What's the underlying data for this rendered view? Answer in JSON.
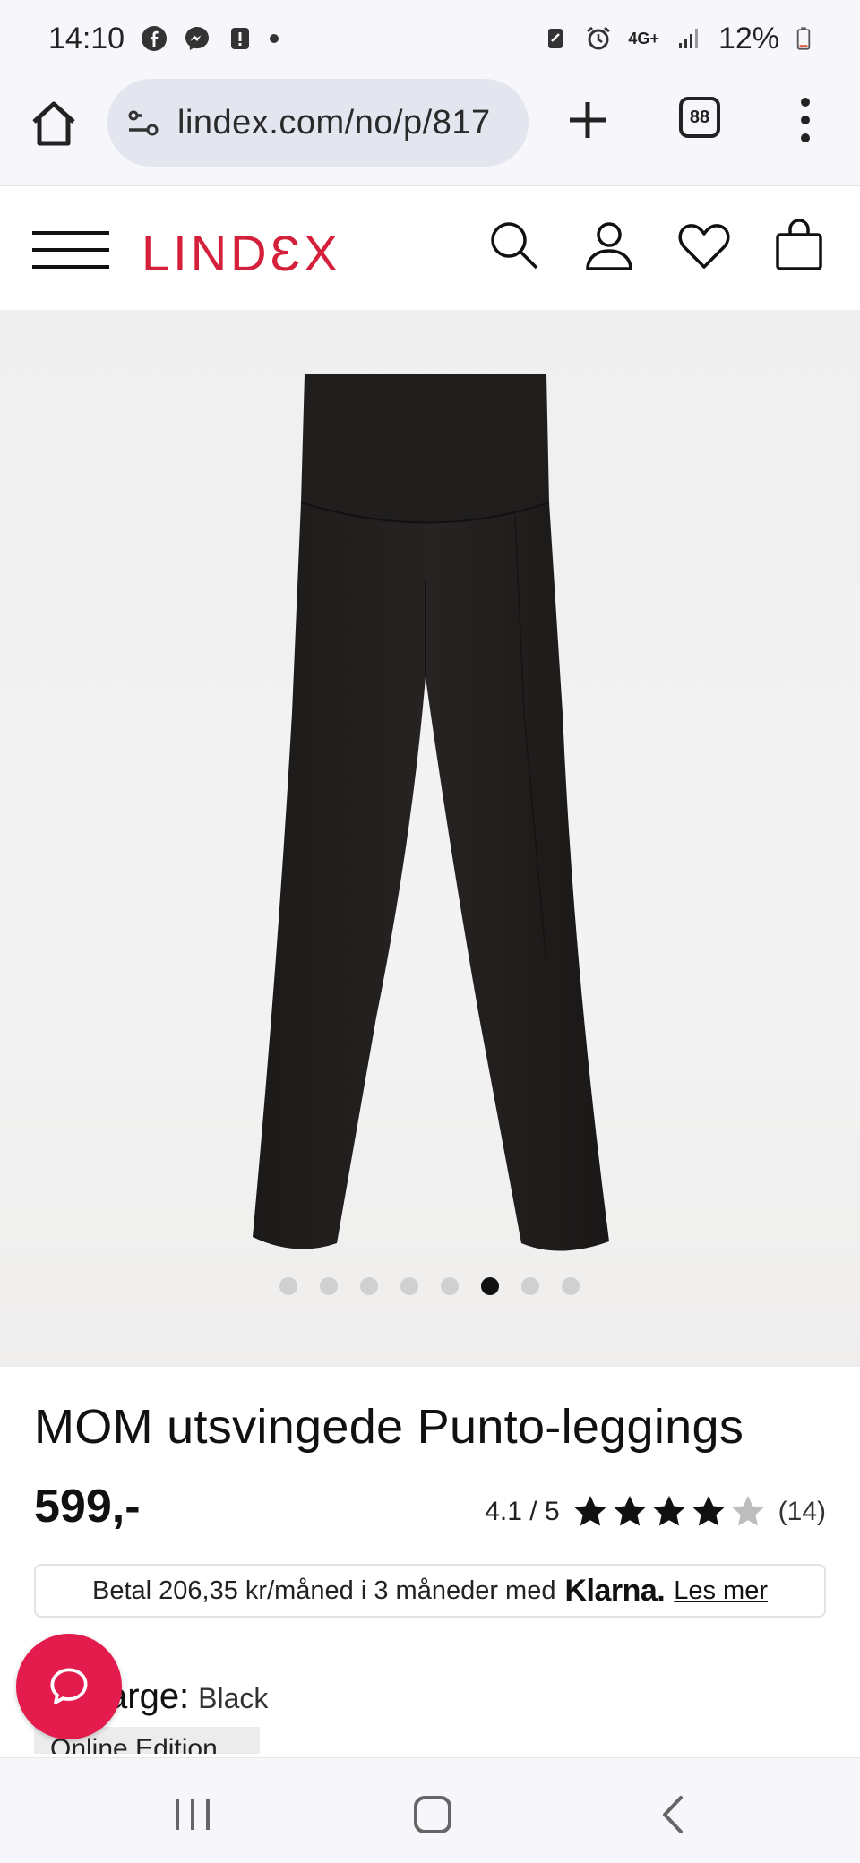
{
  "status_bar": {
    "time": "14:10",
    "battery": "12%",
    "network": "4G+",
    "icons": [
      "facebook-icon",
      "messenger-icon",
      "alert-icon",
      "dot-icon",
      "sim-icon",
      "alarm-icon",
      "signal-icon",
      "battery-icon"
    ]
  },
  "browser": {
    "url": "lindex.com/no/p/817",
    "tab_count": "88",
    "icons": [
      "home-icon",
      "site-settings-icon",
      "plus-icon",
      "tabs-icon",
      "more-icon"
    ]
  },
  "header": {
    "logo": "LINDƐX",
    "icons": [
      "menu-icon",
      "search-icon",
      "account-icon",
      "wishlist-icon",
      "bag-icon"
    ]
  },
  "gallery": {
    "total_images": 8,
    "active_index": 5
  },
  "product": {
    "title": "MOM utsvingede Punto-leggings",
    "price": "599,-",
    "rating_text": "4.1 / 5",
    "rating_value": 4.1,
    "rating_max": 5,
    "review_count": "(14)"
  },
  "klarna": {
    "text": "Betal 206,35 kr/måned i 3 måneder med",
    "brand": "Klarna.",
    "link": "Les mer"
  },
  "color": {
    "label": "arge:",
    "value": "Black"
  },
  "edition_chip": "Online Edition",
  "colors": {
    "brand_red": "#d4203a",
    "chat_red": "#e31c4d",
    "star_fill": "#111111",
    "star_empty": "#bdbdbd"
  },
  "android_nav": {
    "icons": [
      "recents-icon",
      "home-icon",
      "back-icon"
    ]
  }
}
